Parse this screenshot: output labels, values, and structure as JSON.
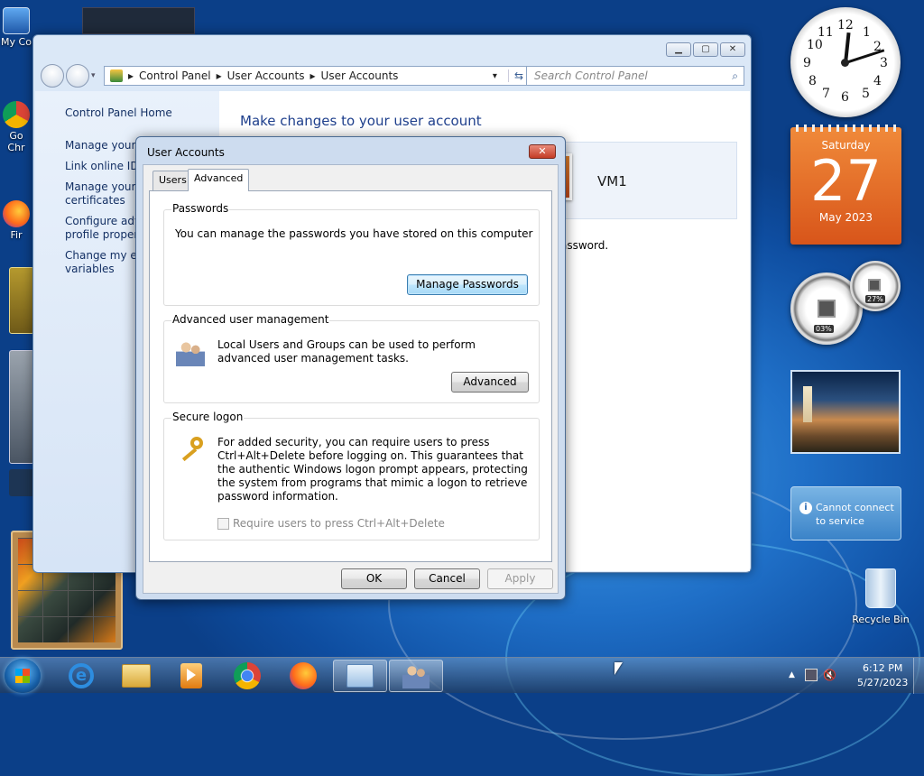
{
  "desktop": {
    "icons": [
      {
        "label": "My Co",
        "icon": "computer-icon"
      },
      {
        "label": "Go\nChr",
        "icon": "chrome-icon"
      },
      {
        "label": "Fir",
        "icon": "firefox-icon"
      }
    ],
    "recycle_bin": "Recycle Bin"
  },
  "control_panel": {
    "breadcrumb": [
      "Control Panel",
      "User Accounts",
      "User Accounts"
    ],
    "search_placeholder": "Search Control Panel",
    "left_links": [
      "Control Panel Home",
      "Manage your c",
      "Link online IDs",
      "Manage your fi",
      "certificates",
      "Configure adva",
      "profile properti",
      "Change my env",
      "variables"
    ],
    "main_title": "Make changes to your user account",
    "account_name": "VM1",
    "partial_text": "assword."
  },
  "dialog": {
    "title": "User Accounts",
    "close": "✕",
    "tabs": [
      "Users",
      "Advanced"
    ],
    "passwords": {
      "heading": "Passwords",
      "text": "You can manage the passwords you have stored on this computer",
      "button": "Manage Passwords"
    },
    "advanced_mgmt": {
      "heading": "Advanced user management",
      "text": "Local Users and Groups can be used to perform advanced user management tasks.",
      "button": "Advanced"
    },
    "secure_logon": {
      "heading": "Secure logon",
      "text": "For added security, you can require users to press Ctrl+Alt+Delete before logging on. This guarantees that the authentic Windows logon prompt appears, protecting the system from programs that mimic a logon to retrieve password information.",
      "checkbox_label": "Require users to press Ctrl+Alt+Delete",
      "checkbox_checked": false
    },
    "buttons": {
      "ok": "OK",
      "cancel": "Cancel",
      "apply": "Apply"
    }
  },
  "gadgets": {
    "clock": {
      "numbers": [
        "12",
        "1",
        "2",
        "3",
        "4",
        "5",
        "6",
        "7",
        "8",
        "9",
        "10",
        "11"
      ]
    },
    "calendar": {
      "weekday": "Saturday",
      "day": "27",
      "month_year": "May 2023"
    },
    "cpu_meter": {
      "cpu": "03%",
      "memory": "27%"
    },
    "weather": {
      "text": "Cannot connect to service"
    }
  },
  "taskbar": {
    "items": [
      "start-orb",
      "ie-icon",
      "explorer-icon",
      "media-player-icon",
      "chrome-icon",
      "firefox-icon",
      "control-panel-icon",
      "user-accounts-icon"
    ],
    "time": "6:12 PM",
    "date": "5/27/2023"
  },
  "colors": {
    "accent": "#1e3f8c",
    "calendar": "#e0661f",
    "focus_button": "#3c7fb1"
  }
}
